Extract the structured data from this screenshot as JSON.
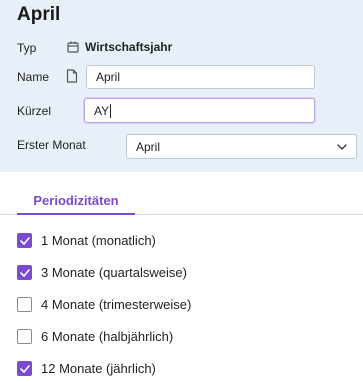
{
  "header": {
    "title": "April",
    "typ": {
      "label": "Typ",
      "value": "Wirtschaftsjahr",
      "icon": "calendar-icon"
    },
    "name": {
      "label": "Name",
      "value": "April",
      "icon": "document-icon"
    },
    "kuerzel": {
      "label": "Kürzel",
      "value": "AY"
    },
    "erster_monat": {
      "label": "Erster Monat",
      "value": "April"
    }
  },
  "tabs": [
    {
      "label": "Periodizitäten",
      "active": true
    }
  ],
  "periodicities": [
    {
      "label": "1 Monat (monatlich)",
      "checked": true
    },
    {
      "label": "3 Monate (quartalsweise)",
      "checked": true
    },
    {
      "label": "4 Monate (trimesterweise)",
      "checked": false
    },
    {
      "label": "6 Monate (halbjährlich)",
      "checked": false
    },
    {
      "label": "12 Monate (jährlich)",
      "checked": true
    }
  ],
  "colors": {
    "accent": "#7b4ad0",
    "header_bg": "#e7f0f8"
  }
}
